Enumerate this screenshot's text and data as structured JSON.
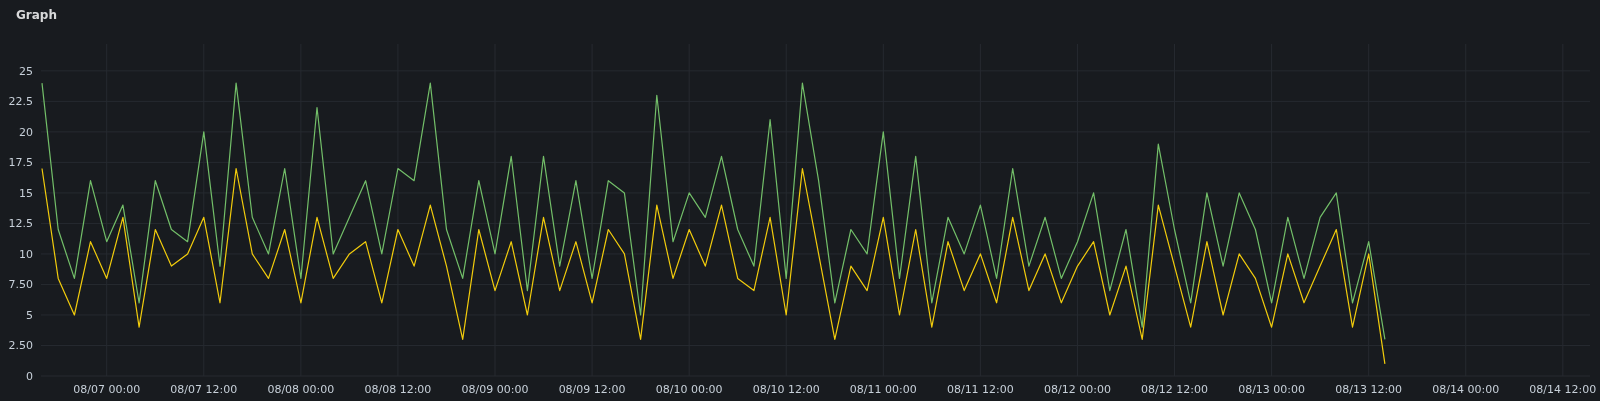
{
  "panel": {
    "title": "Graph",
    "chart_data": {
      "type": "line",
      "categories": [
        null,
        null,
        null,
        null,
        "08/07 00:00",
        null,
        null,
        null,
        null,
        null,
        "08/07 12:00",
        null,
        null,
        null,
        null,
        null,
        "08/08 00:00",
        null,
        null,
        null,
        null,
        null,
        "08/08 12:00",
        null,
        null,
        null,
        null,
        null,
        "08/09 00:00",
        null,
        null,
        null,
        null,
        null,
        "08/09 12:00",
        null,
        null,
        null,
        null,
        null,
        "08/10 00:00",
        null,
        null,
        null,
        null,
        null,
        "08/10 12:00",
        null,
        null,
        null,
        null,
        null,
        "08/11 00:00",
        null,
        null,
        null,
        null,
        null,
        "08/11 12:00",
        null,
        null,
        null,
        null,
        null,
        "08/12 00:00",
        null,
        null,
        null,
        null,
        null,
        "08/12 12:00",
        null,
        null,
        null,
        null,
        null,
        "08/13 00:00",
        null,
        null,
        null,
        null,
        null,
        "08/13 12:00",
        null,
        null,
        null,
        null,
        null,
        "08/14 00:00",
        null,
        null,
        null,
        null,
        null,
        "08/14 12:00",
        null
      ],
      "series": [
        {
          "color": "#73bf69",
          "values": [
            24,
            12,
            8,
            16,
            11,
            14,
            6,
            16,
            12,
            11,
            20,
            9,
            24,
            13,
            10,
            17,
            8,
            22,
            10,
            13,
            16,
            10,
            17,
            16,
            24,
            12,
            8,
            16,
            10,
            18,
            7,
            18,
            9,
            16,
            8,
            16,
            15,
            5,
            23,
            11,
            15,
            13,
            18,
            12,
            9,
            21,
            8,
            24,
            16,
            6,
            12,
            10,
            20,
            8,
            18,
            6,
            13,
            10,
            14,
            8,
            17,
            9,
            13,
            8,
            11,
            15,
            7,
            12,
            4,
            19,
            12,
            6,
            15,
            9,
            15,
            12,
            6,
            13,
            8,
            13,
            15,
            6,
            11,
            3,
            null,
            null,
            null,
            null,
            null,
            null,
            null,
            null,
            null,
            null,
            null,
            null
          ]
        },
        {
          "color": "#f2cc0c",
          "values": [
            17,
            8,
            5,
            11,
            8,
            13,
            4,
            12,
            9,
            10,
            13,
            6,
            17,
            10,
            8,
            12,
            6,
            13,
            8,
            10,
            11,
            6,
            12,
            9,
            14,
            9,
            3,
            12,
            7,
            11,
            5,
            13,
            7,
            11,
            6,
            12,
            10,
            3,
            14,
            8,
            12,
            9,
            14,
            8,
            7,
            13,
            5,
            17,
            10,
            3,
            9,
            7,
            13,
            5,
            12,
            4,
            11,
            7,
            10,
            6,
            13,
            7,
            10,
            6,
            9,
            11,
            5,
            9,
            3,
            14,
            9,
            4,
            11,
            5,
            10,
            8,
            4,
            10,
            6,
            9,
            12,
            4,
            10,
            1,
            null,
            null,
            null,
            null,
            null,
            null,
            null,
            null,
            null,
            null,
            null,
            null
          ]
        }
      ],
      "grid": true,
      "ylim": [
        0,
        27.2
      ],
      "yticks": [
        0,
        {
          "value": 2.5,
          "label": "2.50"
        },
        5,
        {
          "value": 7.5,
          "label": "7.50"
        },
        10,
        12.5,
        15,
        17.5,
        20,
        22.5,
        25
      ]
    }
  }
}
